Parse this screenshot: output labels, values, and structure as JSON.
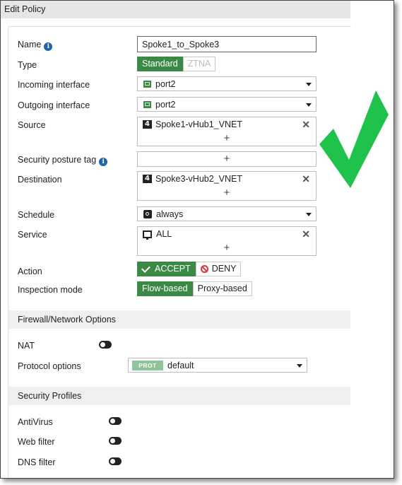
{
  "dialog": {
    "title": "Edit Policy"
  },
  "form": {
    "name": {
      "label": "Name",
      "value": "Spoke1_to_Spoke3"
    },
    "type": {
      "label": "Type",
      "options": [
        "Standard",
        "ZTNA"
      ],
      "selected": "Standard"
    },
    "incoming_interface": {
      "label": "Incoming interface",
      "value": "port2",
      "icon": "port-icon"
    },
    "outgoing_interface": {
      "label": "Outgoing interface",
      "value": "port2",
      "icon": "port-icon"
    },
    "source": {
      "label": "Source",
      "entries": [
        "Spoke1-vHub1_VNET"
      ],
      "add": "+"
    },
    "security_posture_tag": {
      "label": "Security posture tag",
      "add": "+"
    },
    "destination": {
      "label": "Destination",
      "entries": [
        "Spoke3-vHub2_VNET"
      ],
      "add": "+"
    },
    "schedule": {
      "label": "Schedule",
      "value": "always",
      "icon": "clock-icon"
    },
    "service": {
      "label": "Service",
      "entries": [
        "ALL"
      ],
      "add": "+"
    },
    "action": {
      "label": "Action",
      "options": [
        "ACCEPT",
        "DENY"
      ],
      "selected": "ACCEPT"
    },
    "inspection_mode": {
      "label": "Inspection mode",
      "options": [
        "Flow-based",
        "Proxy-based"
      ],
      "selected": "Flow-based"
    }
  },
  "address_icon_glyph": "4",
  "remove_glyph": "✕",
  "firewall_section": {
    "title": "Firewall/Network Options",
    "nat": {
      "label": "NAT",
      "enabled": false
    },
    "protocol_options": {
      "label": "Protocol options",
      "badge": "PROT",
      "value": "default"
    }
  },
  "security_profiles": {
    "title": "Security Profiles",
    "items": [
      {
        "label": "AntiVirus",
        "enabled": false
      },
      {
        "label": "Web filter",
        "enabled": false
      },
      {
        "label": "DNS filter",
        "enabled": false
      }
    ]
  },
  "colors": {
    "accent_green": "#3a8a46",
    "info_blue": "#1f65a7",
    "check_green": "#1fc24a",
    "deny_red": "#d13a3a"
  }
}
